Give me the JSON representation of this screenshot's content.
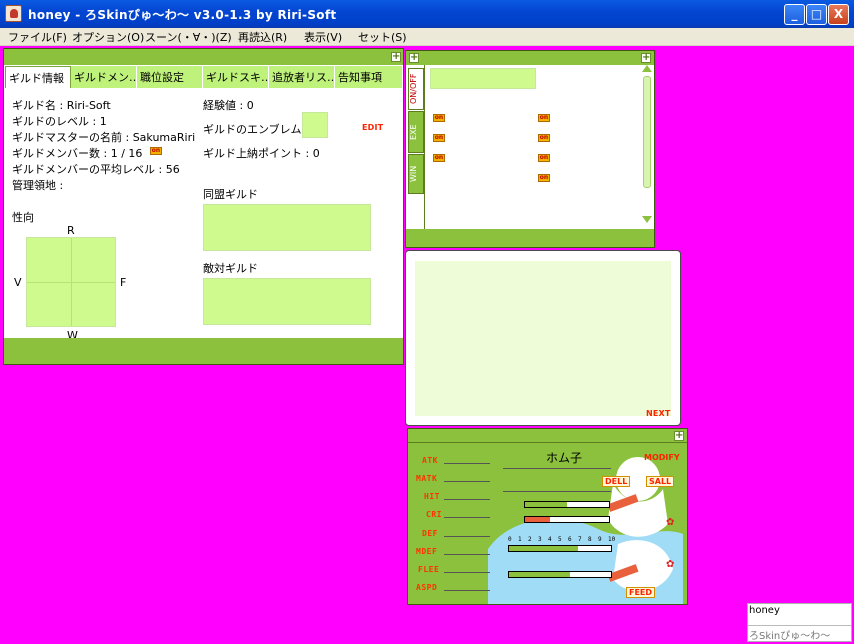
{
  "window": {
    "title": "honey - ろSkinぴゅ～わ～ v3.0-1.3 by Riri-Soft",
    "controls": {
      "minimize": "_",
      "maximize": "□",
      "close": "X"
    }
  },
  "menu": [
    "ファイル(F)",
    "オプション(O)",
    "スーン(・∀・)(Z)",
    "再読込(R)",
    "表示(V)",
    "セット(S)"
  ],
  "guild": {
    "tabs": [
      "ギルド情報",
      "ギルドメン…",
      "職位設定",
      "ギルドスキ…",
      "追放者リス…",
      "告知事項"
    ],
    "name": "ギルド名 : Riri-Soft",
    "level": "ギルドのレベル : 1",
    "master": "ギルドマスターの名前 : SakumaRiri",
    "members": "ギルドメンバー数 : 1 / 16",
    "avg_level": "ギルドメンバーの平均レベル : 56",
    "territory": "管理領地 :",
    "exp": "経験値 : 0",
    "emblem": "ギルドのエンブレム",
    "edit": "EDIT",
    "points": "ギルド上納ポイント : 0",
    "alliance": "同盟ギルド",
    "hostile": "敵対ギルド",
    "alignment": "性向",
    "axes": {
      "top": "R",
      "bottom": "W",
      "left": "V",
      "right": "F"
    },
    "on": "on"
  },
  "skills_panel": {
    "tabs": [
      "ON/OFF",
      "EXE",
      "WIN"
    ],
    "badge": "on"
  },
  "chat": {
    "next": "NEXT"
  },
  "status": {
    "name": "ホム子",
    "labels": [
      "ATK",
      "MATK",
      "HIT",
      "CRI",
      "DEF",
      "MDEF",
      "FLEE",
      "ASPD"
    ],
    "scale": [
      "0",
      "1",
      "2",
      "3",
      "4",
      "5",
      "6",
      "7",
      "8",
      "9",
      "10"
    ],
    "buttons": {
      "modify": "MODIFY",
      "dell": "DELL",
      "sall": "SALL",
      "feed": "FEED"
    },
    "gauges": [
      {
        "name": "hp",
        "fill": 0.5,
        "color": "#8bc13c"
      },
      {
        "name": "sp",
        "fill": 0.3,
        "color": "#e8603c"
      },
      {
        "name": "hunger",
        "fill": 0.68,
        "color": "#8bc13c"
      },
      {
        "name": "intimacy",
        "fill": 0.6,
        "color": "#8bc13c"
      }
    ]
  },
  "taskbox": {
    "line1": "honey",
    "line2": "ろSkinぴゅ～わ～"
  }
}
